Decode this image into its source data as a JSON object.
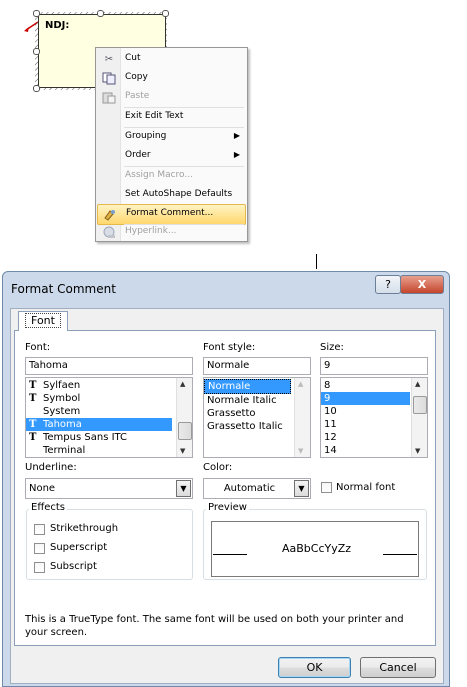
{
  "comment": {
    "label": "NDJ:"
  },
  "context_menu": {
    "items": [
      {
        "label": "Cut",
        "icon": "scissors-icon",
        "enabled": true
      },
      {
        "label": "Copy",
        "icon": "copy-icon",
        "enabled": true
      },
      {
        "label": "Paste",
        "icon": "paste-icon",
        "enabled": false
      },
      {
        "label": "Exit Edit Text",
        "enabled": true
      },
      {
        "label": "Grouping",
        "submenu": true,
        "enabled": true
      },
      {
        "label": "Order",
        "submenu": true,
        "enabled": true
      },
      {
        "label": "Assign Macro...",
        "enabled": false
      },
      {
        "label": "Set AutoShape Defaults",
        "enabled": true
      },
      {
        "label": "Format Comment...",
        "icon": "format-comment-icon",
        "enabled": true,
        "highlighted": true
      },
      {
        "label": "Hyperlink...",
        "icon": "hyperlink-icon",
        "enabled": false
      }
    ]
  },
  "dialog": {
    "title": "Format Comment",
    "help_label": "?",
    "close_label": "X",
    "tab_label": "Font",
    "font": {
      "label": "Font:",
      "value": "Tahoma",
      "list": [
        "Sylfaen",
        "Symbol",
        "System",
        "Tahoma",
        "Tempus Sans ITC",
        "Terminal"
      ],
      "truetype": [
        true,
        true,
        false,
        true,
        true,
        false
      ],
      "selected": "Tahoma"
    },
    "font_style": {
      "label": "Font style:",
      "value": "Normale",
      "list": [
        "Normale",
        "Normale Italic",
        "Grassetto",
        "Grassetto Italic"
      ],
      "selected": "Normale"
    },
    "size": {
      "label": "Size:",
      "value": "9",
      "list": [
        "8",
        "9",
        "10",
        "11",
        "12",
        "14"
      ],
      "selected": "9"
    },
    "underline": {
      "label": "Underline:",
      "value": "None"
    },
    "color": {
      "label": "Color:",
      "value": "Automatic"
    },
    "normal_font": {
      "label": "Normal font",
      "checked": false
    },
    "effects": {
      "label": "Effects",
      "strikethrough": {
        "label": "Strikethrough",
        "checked": false
      },
      "superscript": {
        "label": "Superscript",
        "checked": false
      },
      "subscript": {
        "label": "Subscript",
        "checked": false
      }
    },
    "preview": {
      "label": "Preview",
      "sample": "AaBbCcYyZz"
    },
    "description": "This is a TrueType font.  The same font will be used on both your printer and your screen.",
    "ok_label": "OK",
    "cancel_label": "Cancel"
  },
  "colors": {
    "menu_highlight": "#ffd86e",
    "list_selection": "#3399ff",
    "comment_fill": "#ffffe1",
    "dialog_frame": "#cbd9ea"
  }
}
